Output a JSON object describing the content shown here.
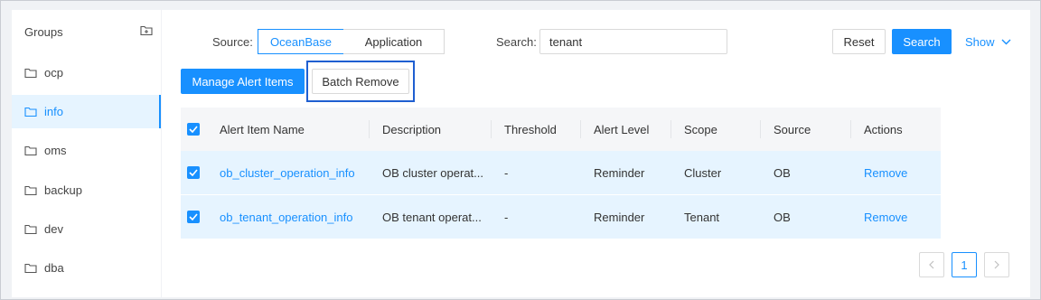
{
  "sidebar": {
    "title": "Groups",
    "add_icon": "folder-add-icon",
    "items": [
      {
        "label": "ocp",
        "active": false
      },
      {
        "label": "info",
        "active": true
      },
      {
        "label": "oms",
        "active": false
      },
      {
        "label": "backup",
        "active": false
      },
      {
        "label": "dev",
        "active": false
      },
      {
        "label": "dba",
        "active": false
      }
    ]
  },
  "filters": {
    "source_label": "Source:",
    "source_options": [
      "OceanBase",
      "Application"
    ],
    "source_selected": "OceanBase",
    "search_label": "Search:",
    "search_value": "tenant",
    "reset_label": "Reset",
    "search_button_label": "Search",
    "show_label": "Show"
  },
  "toolbar": {
    "manage_label": "Manage Alert Items",
    "batch_remove_label": "Batch Remove"
  },
  "table": {
    "columns": [
      "Alert Item Name",
      "Description",
      "Threshold",
      "Alert Level",
      "Scope",
      "Source",
      "Actions"
    ],
    "rows": [
      {
        "name": "ob_cluster_operation_info",
        "description": "OB cluster operat...",
        "threshold": "-",
        "level": "Reminder",
        "scope": "Cluster",
        "source": "OB",
        "action": "Remove",
        "checked": true
      },
      {
        "name": "ob_tenant_operation_info",
        "description": "OB tenant operat...",
        "threshold": "-",
        "level": "Reminder",
        "scope": "Tenant",
        "source": "OB",
        "action": "Remove",
        "checked": true
      }
    ],
    "header_checked": true
  },
  "pagination": {
    "current_page": "1",
    "prev_icon": "chevron-left-icon",
    "next_icon": "chevron-right-icon"
  },
  "colors": {
    "accent": "#1890ff",
    "selected_row": "#e6f4ff",
    "highlight_border": "#1f5fd1"
  }
}
